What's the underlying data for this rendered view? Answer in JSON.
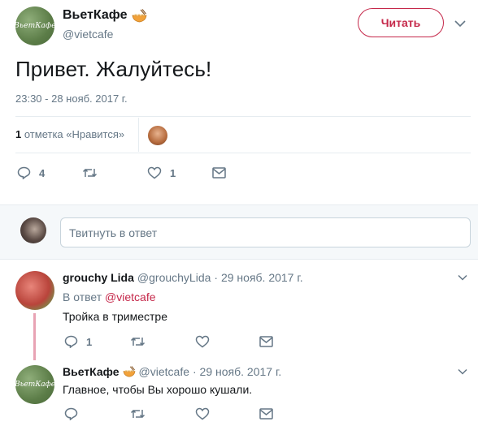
{
  "tweet": {
    "author_name": "ВьетКафе",
    "author_handle": "@vietcafe",
    "avatar_text": "ВьетКафе",
    "follow_label": "Читать",
    "text": "Привет. Жалуйтесь!",
    "timestamp": "23:30 - 28 нояб. 2017 г.",
    "likes_count": "1",
    "likes_label": "отметка «Нравится»",
    "actions": {
      "reply_count": "4",
      "retweet_count": "",
      "like_count": "1"
    }
  },
  "reply_box": {
    "placeholder": "Твитнуть в ответ"
  },
  "replies": [
    {
      "name": "grouchy Lida",
      "handle": "@grouchyLida",
      "date": "· 29 нояб. 2017 г.",
      "reply_to_prefix": "В ответ",
      "reply_to_handle": "@vietcafe",
      "text": "Тройка в триместре",
      "reply_count": "1"
    },
    {
      "name": "ВьетКафе",
      "handle": "@vietcafe",
      "date": "· 29 нояб. 2017 г.",
      "avatar_text": "ВьетКафе",
      "text": "Главное, чтобы Вы хорошо кушали.",
      "reply_count": ""
    }
  ],
  "colors": {
    "accent": "#c5284a",
    "muted": "#657786",
    "thread_line": "#e8a3b4"
  }
}
